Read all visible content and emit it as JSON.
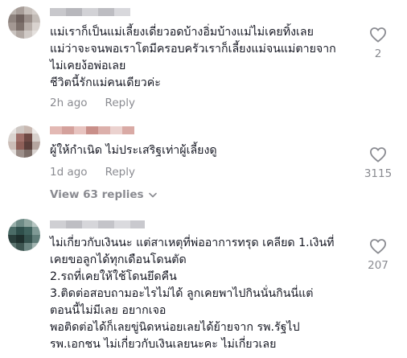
{
  "comments": [
    {
      "text": "แม่เราก็เป็นแม่เลี้ยงเดี่ยวอดบ้างอิ่มบ้างแม่ไม่เคยทิ้งเลย\nแม่ว่าจะจนพอเราโตมีครอบครัวเราก็เลี้ยงแม่จนแม่ตายจาก\nไม่เคยง้อพ่อเลย\nชีวิตนี้รักแม่คนเดียวค่ะ",
      "time": "2h ago",
      "reply_label": "Reply",
      "likes": "2"
    },
    {
      "text": "ผู้ให้กำเนิด ไม่ประเสริฐเท่าผู้เลี้ยงดู",
      "time": "1d ago",
      "reply_label": "Reply",
      "likes": "3115",
      "view_replies_label": "View 63 replies"
    },
    {
      "text": "ไม่เกี่ยวกับเงินนะ แต่สาเหตุที่พ่ออาการทรุด เคลียด 1.เงินที่\nเคยขอลูกได้ทุกเดือนโดนตัด\n2.รถที่เคยให้ใช้โดนยึดคืน\n3.ติดต่อสอบถามอะไรไม่ได้ ลูกเคยพาไปกินนั่นกินนี่แต่\nตอนนี้ไม่มีเลย อยากเจอ\nพอติดต่อได้ก็เลยขู่นิดหน่อยเลยได้ย้ายจาก รพ.รัฐไป\nรพ.เอกชน ไม่เกี่ยวกับเงินเลยนะคะ ไม่เกี่ยวเลย",
      "likes": "207"
    }
  ],
  "colors": {
    "text": "#161823",
    "muted": "#8a8b91",
    "heart_outline": "#8a8b91"
  },
  "icons": {
    "like": "heart-outline-icon",
    "expand": "chevron-down-icon"
  }
}
